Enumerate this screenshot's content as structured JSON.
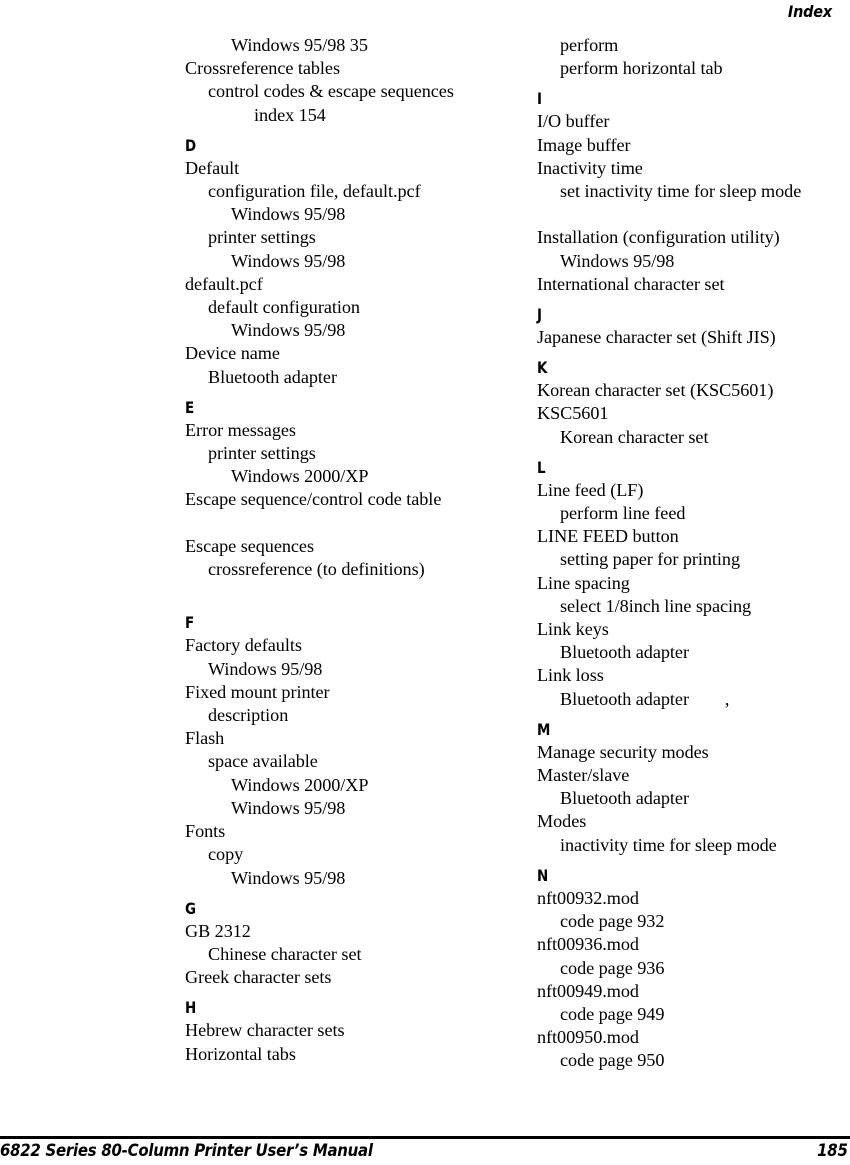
{
  "header": {
    "title": "Index"
  },
  "footer": {
    "manual_title": "6822 Series 80-Column Printer User’s Manual",
    "page_number": "185"
  },
  "columns": {
    "left": [
      {
        "kind": "entry",
        "level": 2,
        "text": "Windows 95/98 35"
      },
      {
        "kind": "entry",
        "level": 0,
        "text": "Crossreference tables"
      },
      {
        "kind": "entry",
        "level": 1,
        "text": "control codes & escape sequences"
      },
      {
        "kind": "entry",
        "level": 3,
        "text": "index 154"
      },
      {
        "kind": "letter",
        "text": "D"
      },
      {
        "kind": "entry",
        "level": 0,
        "text": "Default"
      },
      {
        "kind": "entry",
        "level": 1,
        "text": "configuration file, default.pcf"
      },
      {
        "kind": "entry",
        "level": 2,
        "text": "Windows 95/98"
      },
      {
        "kind": "entry",
        "level": 1,
        "text": "printer settings"
      },
      {
        "kind": "entry",
        "level": 2,
        "text": "Windows 95/98"
      },
      {
        "kind": "entry",
        "level": 0,
        "text": "default.pcf"
      },
      {
        "kind": "entry",
        "level": 1,
        "text": "default configuration"
      },
      {
        "kind": "entry",
        "level": 2,
        "text": "Windows 95/98"
      },
      {
        "kind": "entry",
        "level": 0,
        "text": "Device name"
      },
      {
        "kind": "entry",
        "level": 1,
        "text": "Bluetooth adapter"
      },
      {
        "kind": "letter",
        "text": "E"
      },
      {
        "kind": "entry",
        "level": 0,
        "text": "Error messages"
      },
      {
        "kind": "entry",
        "level": 1,
        "text": "printer settings"
      },
      {
        "kind": "entry",
        "level": 2,
        "text": "Windows 2000/XP"
      },
      {
        "kind": "entry",
        "level": 0,
        "text": "Escape sequence/control code table"
      },
      {
        "kind": "blank",
        "text": ""
      },
      {
        "kind": "entry",
        "level": 0,
        "text": "Escape sequences"
      },
      {
        "kind": "entry",
        "level": 1,
        "text": "crossreference (to definitions)"
      },
      {
        "kind": "blank",
        "text": ""
      },
      {
        "kind": "letter",
        "text": "F"
      },
      {
        "kind": "entry",
        "level": 0,
        "text": "Factory defaults"
      },
      {
        "kind": "entry",
        "level": 1,
        "text": "Windows 95/98"
      },
      {
        "kind": "entry",
        "level": 0,
        "text": "Fixed mount printer"
      },
      {
        "kind": "entry",
        "level": 1,
        "text": "description"
      },
      {
        "kind": "entry",
        "level": 0,
        "text": "Flash"
      },
      {
        "kind": "entry",
        "level": 1,
        "text": "space available"
      },
      {
        "kind": "entry",
        "level": 2,
        "text": "Windows 2000/XP"
      },
      {
        "kind": "entry",
        "level": 2,
        "text": "Windows 95/98"
      },
      {
        "kind": "entry",
        "level": 0,
        "text": "Fonts"
      },
      {
        "kind": "entry",
        "level": 1,
        "text": "copy"
      },
      {
        "kind": "entry",
        "level": 2,
        "text": "Windows 95/98"
      },
      {
        "kind": "letter",
        "text": "G"
      },
      {
        "kind": "entry",
        "level": 0,
        "text": "GB 2312"
      },
      {
        "kind": "entry",
        "level": 1,
        "text": "Chinese character set"
      },
      {
        "kind": "entry",
        "level": 0,
        "text": "Greek character sets"
      },
      {
        "kind": "letter",
        "text": "H"
      },
      {
        "kind": "entry",
        "level": 0,
        "text": "Hebrew character sets"
      },
      {
        "kind": "entry",
        "level": 0,
        "text": "Horizontal tabs"
      }
    ],
    "right": [
      {
        "kind": "entry",
        "level": 1,
        "text": "perform"
      },
      {
        "kind": "entry",
        "level": 1,
        "text": "perform horizontal tab"
      },
      {
        "kind": "letter",
        "text": "I"
      },
      {
        "kind": "entry",
        "level": 0,
        "text": "I/O buffer"
      },
      {
        "kind": "entry",
        "level": 0,
        "text": "Image buffer"
      },
      {
        "kind": "entry",
        "level": 0,
        "text": "Inactivity time"
      },
      {
        "kind": "entry",
        "level": 1,
        "text": "set inactivity time for sleep mode"
      },
      {
        "kind": "blank",
        "text": ""
      },
      {
        "kind": "entry",
        "level": 0,
        "text": "Installation (configuration utility)"
      },
      {
        "kind": "entry",
        "level": 1,
        "text": "Windows 95/98"
      },
      {
        "kind": "entry",
        "level": 0,
        "text": "International character set"
      },
      {
        "kind": "letter",
        "text": "J"
      },
      {
        "kind": "entry",
        "level": 0,
        "text": "Japanese character set (Shift JIS)"
      },
      {
        "kind": "letter",
        "text": "K"
      },
      {
        "kind": "entry",
        "level": 0,
        "text": "Korean character set (KSC5601)"
      },
      {
        "kind": "entry",
        "level": 0,
        "text": "KSC5601"
      },
      {
        "kind": "entry",
        "level": 1,
        "text": "Korean character set"
      },
      {
        "kind": "letter",
        "text": "L"
      },
      {
        "kind": "entry",
        "level": 0,
        "text": "Line feed (LF)"
      },
      {
        "kind": "entry",
        "level": 1,
        "text": "perform line feed"
      },
      {
        "kind": "entry",
        "level": 0,
        "text": "LINE FEED button"
      },
      {
        "kind": "entry",
        "level": 1,
        "text": "setting paper for printing"
      },
      {
        "kind": "entry",
        "level": 0,
        "text": "Line spacing"
      },
      {
        "kind": "entry",
        "level": 1,
        "text": "select 1/8inch line spacing"
      },
      {
        "kind": "entry",
        "level": 0,
        "text": "Link keys"
      },
      {
        "kind": "entry",
        "level": 1,
        "text": "Bluetooth adapter"
      },
      {
        "kind": "entry",
        "level": 0,
        "text": "Link loss"
      },
      {
        "kind": "entry",
        "level": 1,
        "text": "Bluetooth adapter        ,"
      },
      {
        "kind": "letter",
        "text": "M"
      },
      {
        "kind": "entry",
        "level": 0,
        "text": "Manage security modes"
      },
      {
        "kind": "entry",
        "level": 0,
        "text": "Master/slave"
      },
      {
        "kind": "entry",
        "level": 1,
        "text": "Bluetooth adapter"
      },
      {
        "kind": "entry",
        "level": 0,
        "text": "Modes"
      },
      {
        "kind": "entry",
        "level": 1,
        "text": "inactivity time for sleep mode"
      },
      {
        "kind": "letter",
        "text": "N"
      },
      {
        "kind": "entry",
        "level": 0,
        "text": "nft00932.mod"
      },
      {
        "kind": "entry",
        "level": 1,
        "text": "code page 932"
      },
      {
        "kind": "entry",
        "level": 0,
        "text": "nft00936.mod"
      },
      {
        "kind": "entry",
        "level": 1,
        "text": "code page 936"
      },
      {
        "kind": "entry",
        "level": 0,
        "text": "nft00949.mod"
      },
      {
        "kind": "entry",
        "level": 1,
        "text": "code page 949"
      },
      {
        "kind": "entry",
        "level": 0,
        "text": "nft00950.mod"
      },
      {
        "kind": "entry",
        "level": 1,
        "text": "code page 950"
      }
    ]
  }
}
